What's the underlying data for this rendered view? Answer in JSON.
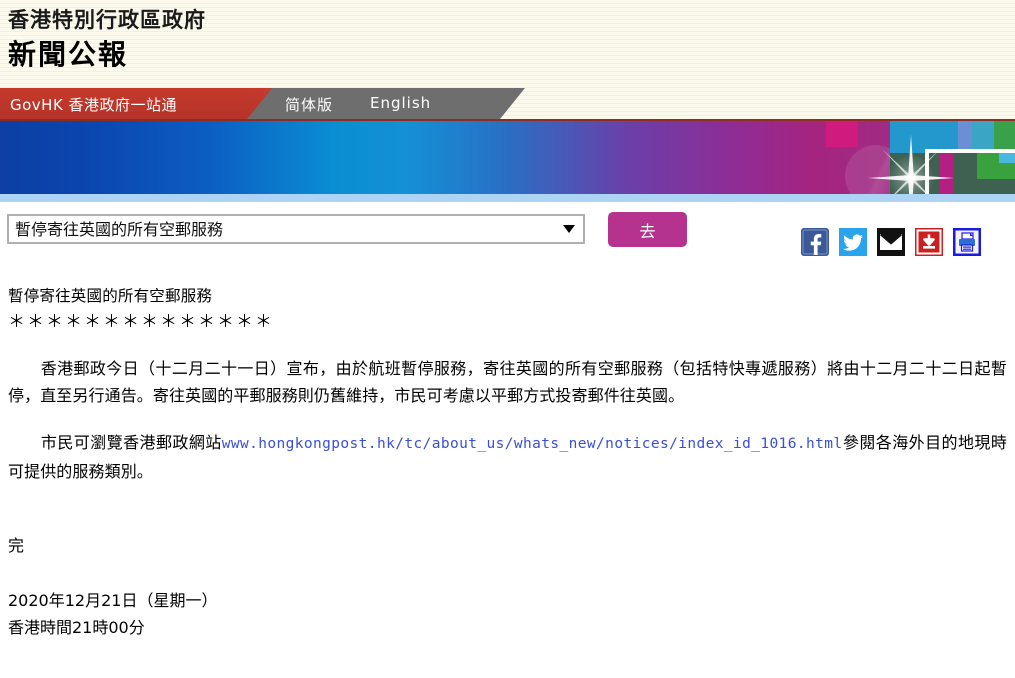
{
  "masthead": {
    "line1": "香港特別行政區政府",
    "line2": "新聞公報"
  },
  "nav": {
    "govhk": "GovHK 香港政府一站通",
    "simplified": "简体版",
    "english": "English"
  },
  "controls": {
    "select_value": "暫停寄往英國的所有空郵服務",
    "go_label": "去",
    "social": [
      {
        "name": "facebook-icon",
        "color": "#3b5998"
      },
      {
        "name": "twitter-icon",
        "color": "#29a3ec"
      },
      {
        "name": "email-icon",
        "color": "#000000"
      },
      {
        "name": "download-icon",
        "color": "#cc1f1f"
      },
      {
        "name": "print-icon",
        "color": "#1a1ae0"
      }
    ]
  },
  "article": {
    "title": "暫停寄往英國的所有空郵服務",
    "stars": "＊＊＊＊＊＊＊＊＊＊＊＊＊＊",
    "para1": "　　香港郵政今日（十二月二十一日）宣布，由於航班暫停服務，寄往英國的所有空郵服務（包括特快專遞服務）將由十二月二十二日起暫停，直至另行通告。寄往英國的平郵服務則仍舊維持，市民可考慮以平郵方式投寄郵件往英國。",
    "para2_before": "　　市民可瀏覽香港郵政網站",
    "para2_link": "www.hongkongpost.hk/tc/about_us/whats_new/notices/index_id_1016.html",
    "para2_after": "參閱各海外目的地現時可提供的服務類別。",
    "end_mark": "完",
    "date": "2020年12月21日（星期一）",
    "time": "香港時間21時00分"
  },
  "colors": {
    "nav_red": "#c0392b",
    "nav_gray": "#6e6e6e",
    "go_button": "#b5328f",
    "link": "#3a4fd6",
    "masthead_bg": "#fbfaec"
  }
}
